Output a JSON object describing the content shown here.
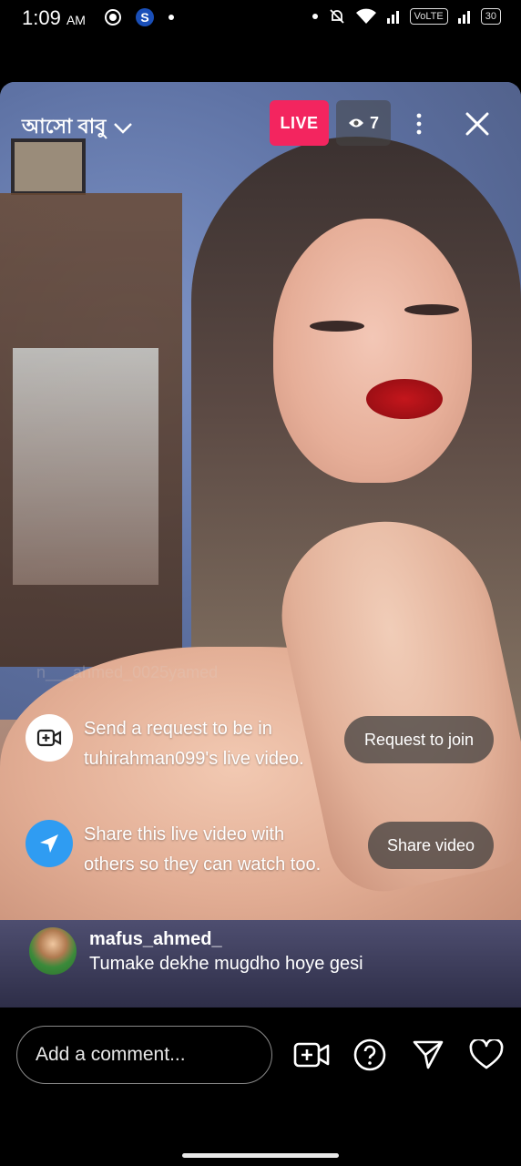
{
  "status_bar": {
    "time": "1:09",
    "ampm": "AM",
    "volte_label": "VoLTE",
    "battery": "30"
  },
  "live": {
    "streamer_name": "আসো বাবু",
    "live_label": "LIVE",
    "viewer_count": "7"
  },
  "faded_comment": "n___ahmed_0025yamed",
  "notices": [
    {
      "text": "Send a request to be in tuhirahman099's live video.",
      "button": "Request to join"
    },
    {
      "text": "Share this live video with others so they can watch too.",
      "button": "Share video"
    }
  ],
  "comment": {
    "username": "mafus_ahmed_",
    "text": "Tumake dekhe mugdho hoye gesi"
  },
  "bottom": {
    "placeholder": "Add a comment..."
  },
  "colors": {
    "live_badge": "#f3255f",
    "share_icon_bg": "#2f9cf2"
  }
}
